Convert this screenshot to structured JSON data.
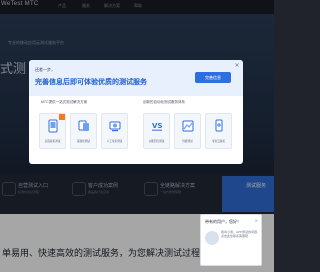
{
  "site": {
    "logo": "WeTest MTC",
    "nav": [
      "产品",
      "服务",
      "解决方案",
      "帮助"
    ],
    "hero_title": "式测",
    "hero_subtitle": "专业的移动应用云测试服务平台",
    "features": [
      {
        "title": "自营测试入口",
        "sub": "标准化测试流程"
      },
      {
        "title": "客户成功案例",
        "sub": "覆盖各行业应用"
      },
      {
        "title": "全链路解决方案",
        "sub": "一站式质量保障"
      }
    ],
    "feature_highlight": "测试服务",
    "slogan": "单易用、快速高效的测试服务，为您解决测试过程中的设备"
  },
  "modal": {
    "kicker": "还差一步，",
    "title": "完善信息后即可体验优质的测试服务",
    "button": "完善信息",
    "close": "×",
    "groups": [
      {
        "title": "MTC提供一站式测试解决方案"
      },
      {
        "title": "创新的自动化测试服务体系"
      }
    ],
    "cards": [
      {
        "label": "远程真机调试",
        "icon": "phone-icon",
        "badge": true
      },
      {
        "label": "兼容性测试",
        "icon": "compat-icon",
        "badge": false
      },
      {
        "label": "人工专家测试",
        "icon": "expert-icon",
        "badge": false
      },
      {
        "label": "功能回归测试",
        "icon": "vs-icon",
        "badge": false
      },
      {
        "label": "性能测试",
        "icon": "performance-icon",
        "badge": false
      },
      {
        "label": "专家云真机",
        "icon": "cloud-phone-icon",
        "badge": false
      }
    ]
  },
  "chat": {
    "question": "带有的用户，您好！",
    "close": "×",
    "body": "我叫小测，APP测试的问题，点击此处联系客服吧"
  },
  "colors": {
    "accent": "#2e6fe0",
    "badge": "#f27a23"
  }
}
